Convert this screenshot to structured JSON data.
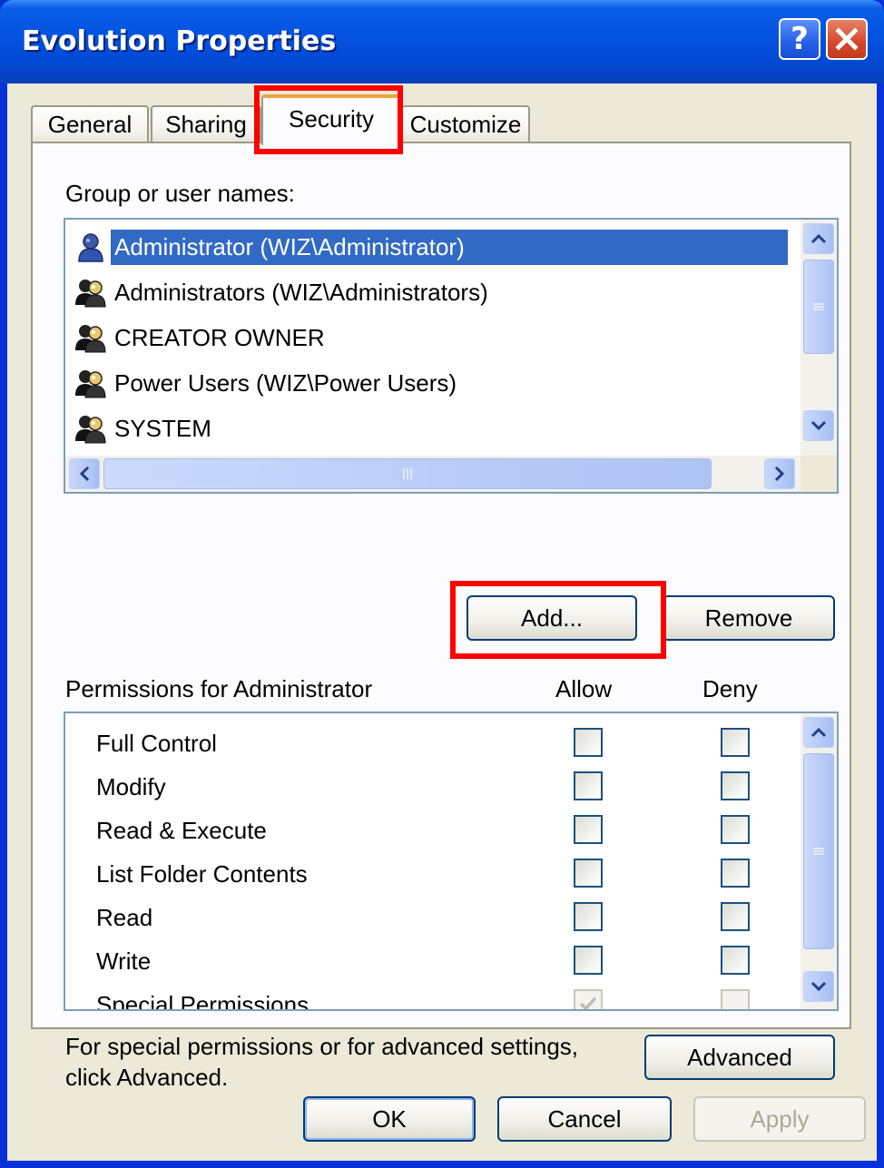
{
  "window": {
    "title": "Evolution Properties",
    "help_glyph": "?",
    "close_icon": "close-icon"
  },
  "tabs": [
    {
      "label": "General"
    },
    {
      "label": "Sharing"
    },
    {
      "label": "Security",
      "active": true
    },
    {
      "label": "Customize"
    }
  ],
  "security": {
    "group_label": "Group or user names:",
    "groups": [
      {
        "name": "Administrator (WIZ\\Administrator)",
        "icon": "user-icon",
        "selected": true
      },
      {
        "name": "Administrators (WIZ\\Administrators)",
        "icon": "users-group-icon"
      },
      {
        "name": "CREATOR OWNER",
        "icon": "users-group-icon"
      },
      {
        "name": "Power Users (WIZ\\Power Users)",
        "icon": "users-group-icon"
      },
      {
        "name": "SYSTEM",
        "icon": "users-group-icon"
      }
    ],
    "add_label": "Add...",
    "remove_label": "Remove",
    "permissions_label": "Permissions for Administrator",
    "allow_label": "Allow",
    "deny_label": "Deny",
    "permissions": [
      {
        "name": "Full Control",
        "allow": false,
        "deny": false
      },
      {
        "name": "Modify",
        "allow": false,
        "deny": false
      },
      {
        "name": "Read & Execute",
        "allow": false,
        "deny": false
      },
      {
        "name": "List Folder Contents",
        "allow": false,
        "deny": false
      },
      {
        "name": "Read",
        "allow": false,
        "deny": false
      },
      {
        "name": "Write",
        "allow": false,
        "deny": false
      },
      {
        "name": "Special Permissions",
        "allow": true,
        "deny": false
      }
    ],
    "advanced_text": "For special permissions or for advanced settings, click Advanced.",
    "advanced_label": "Advanced"
  },
  "footer": {
    "ok_label": "OK",
    "cancel_label": "Cancel",
    "apply_label": "Apply"
  },
  "colors": {
    "highlight_box": "#ff0000",
    "selection": "#316ac5",
    "titlebar": "#0352e0"
  }
}
